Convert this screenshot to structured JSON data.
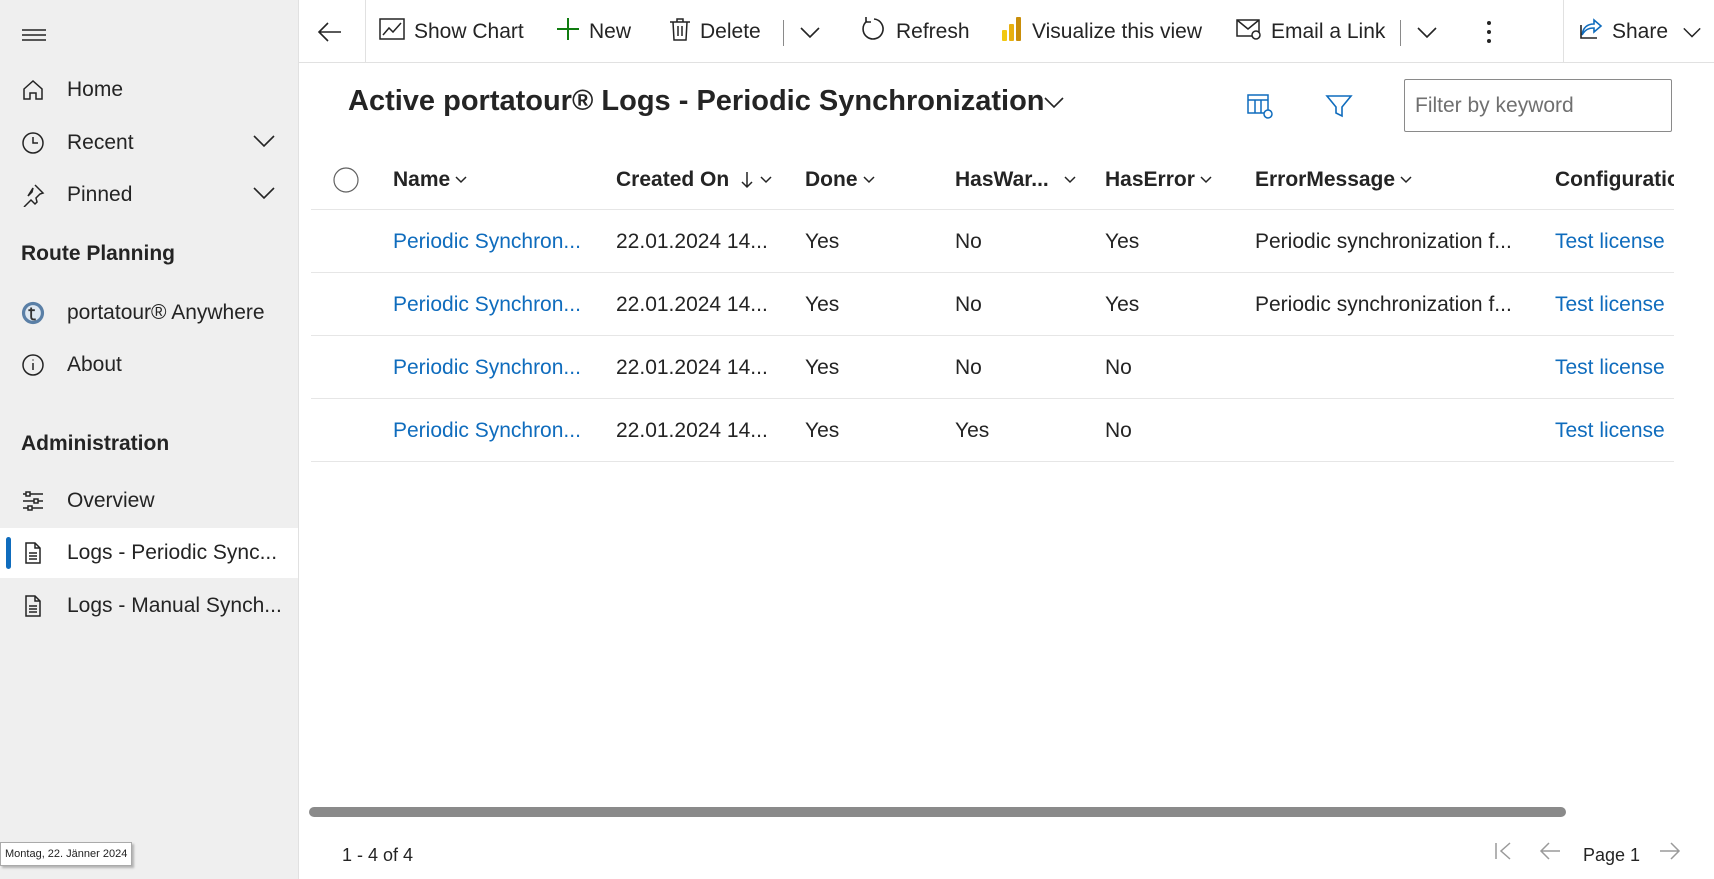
{
  "sidebar": {
    "items": [
      {
        "label": "Home",
        "icon": "home-icon"
      },
      {
        "label": "Recent",
        "icon": "clock-icon"
      },
      {
        "label": "Pinned",
        "icon": "pin-icon"
      }
    ],
    "groups": [
      {
        "title": "Route Planning",
        "items": [
          {
            "label": "portatour® Anywhere",
            "icon": "portatour-logo-icon"
          },
          {
            "label": "About",
            "icon": "info-icon"
          }
        ]
      },
      {
        "title": "Administration",
        "items": [
          {
            "label": "Overview",
            "icon": "sliders-icon"
          },
          {
            "label": "Logs - Periodic Sync...",
            "icon": "document-icon",
            "active": true
          },
          {
            "label": "Logs - Manual Synch...",
            "icon": "document-icon"
          }
        ]
      }
    ]
  },
  "date_tooltip": "Montag, 22. Jänner 2024",
  "toolbar": {
    "show_chart": "Show Chart",
    "new": "New",
    "delete": "Delete",
    "refresh": "Refresh",
    "visualize": "Visualize this view",
    "email_link": "Email a Link",
    "share": "Share"
  },
  "view": {
    "title": "Active portatour® Logs - Periodic Synchronization",
    "filter_placeholder": "Filter by keyword"
  },
  "grid": {
    "columns": [
      "Name",
      "Created On",
      "Done",
      "HasWar...",
      "HasError",
      "ErrorMessage",
      "Configuratio"
    ],
    "rows": [
      {
        "name": "Periodic Synchron...",
        "created_on": "22.01.2024 14...",
        "done": "Yes",
        "has_warning": "No",
        "has_error": "Yes",
        "error_message": "Periodic synchronization f...",
        "configuration": "Test license"
      },
      {
        "name": "Periodic Synchron...",
        "created_on": "22.01.2024 14...",
        "done": "Yes",
        "has_warning": "No",
        "has_error": "Yes",
        "error_message": "Periodic synchronization f...",
        "configuration": "Test license"
      },
      {
        "name": "Periodic Synchron...",
        "created_on": "22.01.2024 14...",
        "done": "Yes",
        "has_warning": "No",
        "has_error": "No",
        "error_message": "",
        "configuration": "Test license"
      },
      {
        "name": "Periodic Synchron...",
        "created_on": "22.01.2024 14...",
        "done": "Yes",
        "has_warning": "Yes",
        "has_error": "No",
        "error_message": "",
        "configuration": "Test license"
      }
    ]
  },
  "footer": {
    "record_count": "1 - 4 of 4",
    "page_label": "Page 1"
  },
  "colors": {
    "accent": "#0f6cbd",
    "sidebar_bg": "#efefef",
    "text": "#242424"
  }
}
